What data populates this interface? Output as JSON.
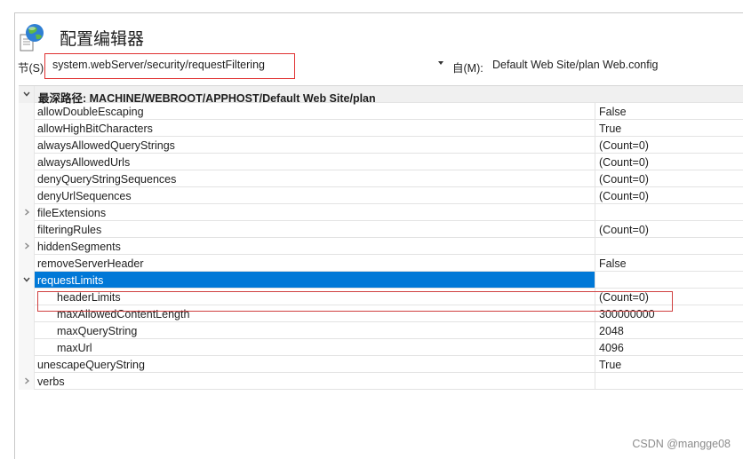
{
  "header": {
    "title": "配置编辑器",
    "icon": "config-globe-icon"
  },
  "section": {
    "label": "节(S):",
    "value": "system.webServer/security/requestFiltering",
    "from_label": "自(M):",
    "from_value": "Default Web Site/plan Web.config"
  },
  "grid": {
    "group_title": "最深路径: MACHINE/WEBROOT/APPHOST/Default Web Site/plan",
    "rows": [
      {
        "name": "allowDoubleEscaping",
        "value": "False"
      },
      {
        "name": "allowHighBitCharacters",
        "value": "True"
      },
      {
        "name": "alwaysAllowedQueryStrings",
        "value": "(Count=0)"
      },
      {
        "name": "alwaysAllowedUrls",
        "value": "(Count=0)"
      },
      {
        "name": "denyQueryStringSequences",
        "value": "(Count=0)"
      },
      {
        "name": "denyUrlSequences",
        "value": "(Count=0)"
      },
      {
        "name": "fileExtensions",
        "value": ""
      },
      {
        "name": "filteringRules",
        "value": "(Count=0)"
      },
      {
        "name": "hiddenSegments",
        "value": ""
      },
      {
        "name": "removeServerHeader",
        "value": "False"
      },
      {
        "name": "requestLimits",
        "value": ""
      },
      {
        "name": "headerLimits",
        "value": "(Count=0)"
      },
      {
        "name": "maxAllowedContentLength",
        "value": "300000000"
      },
      {
        "name": "maxQueryString",
        "value": "2048"
      },
      {
        "name": "maxUrl",
        "value": "4096"
      },
      {
        "name": "unescapeQueryString",
        "value": "True"
      },
      {
        "name": "verbs",
        "value": ""
      }
    ]
  },
  "watermark": "CSDN @mangge08",
  "colors": {
    "selection": "#0078d7",
    "highlight_border": "#d04040"
  }
}
